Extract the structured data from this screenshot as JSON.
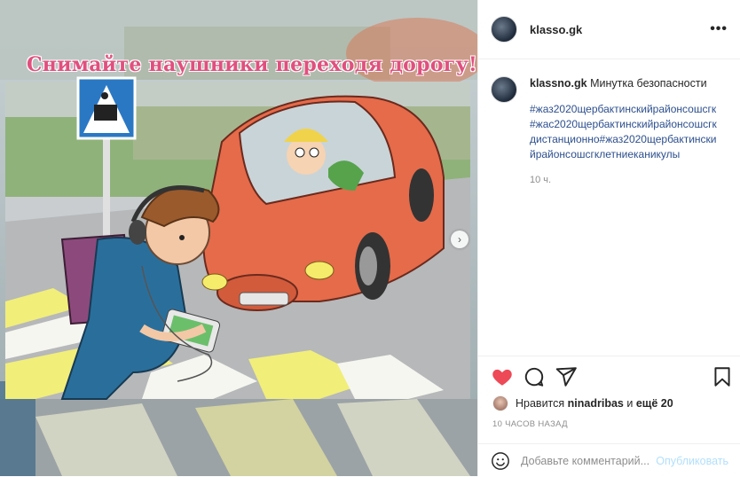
{
  "post": {
    "username": "klasso.gk",
    "more_label": "•••",
    "image_banner": "Снимайте наушники переходя дорогу!",
    "caption_user": "klassno.gk",
    "caption_text": "Минутка безопасности",
    "hashtags": "#жаз2020щербактинскийрайонсошсгк#жас2020щербактинскийрайонсошсгкдистанционно#жаз2020щербактинскийрайонсошсгклетниеканикулы",
    "time_ago": "10 ч.",
    "likes_prefix": "Нравится",
    "likes_user": "ninadribas",
    "likes_joiner": "и",
    "likes_others": "ещё 20",
    "posted_ago": "10 ЧАСОВ НАЗАД",
    "comment_placeholder": "Добавьте комментарий...",
    "publish_label": "Опубликовать",
    "next_arrow": "›"
  },
  "colors": {
    "like_red": "#ed4956",
    "link_blue": "#2c4f8d",
    "publish_disabled": "#b2dffc"
  },
  "icons": [
    "heart-icon",
    "comment-icon",
    "share-icon",
    "bookmark-icon",
    "emoji-icon",
    "more-icon",
    "next-icon"
  ]
}
